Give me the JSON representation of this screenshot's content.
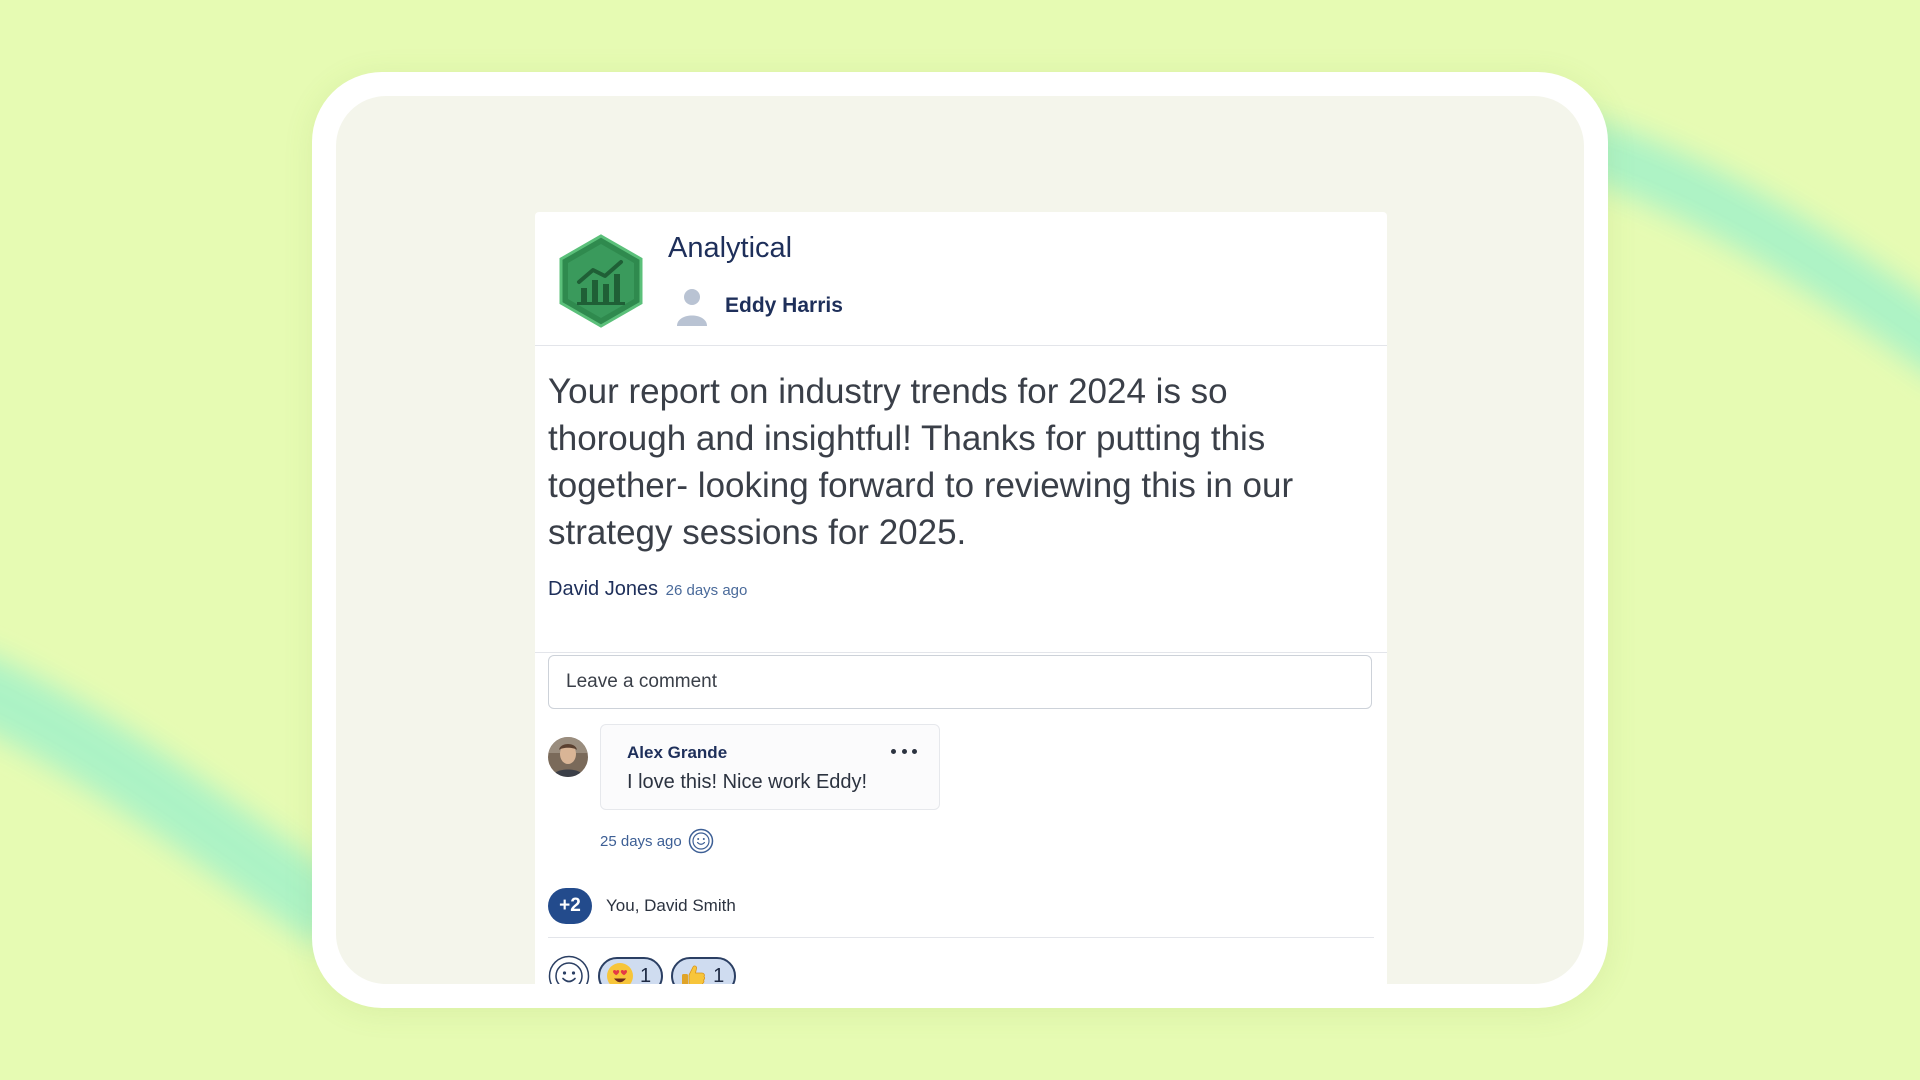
{
  "post": {
    "badge_title": "Analytical",
    "recipient": "Eddy Harris",
    "message": "Your report on industry trends for 2024 is so thorough and insightful! Thanks for putting this together- looking forward to reviewing this in our strategy sessions for 2025.",
    "sender": "David Jones",
    "sent_time": "26 days ago"
  },
  "comment_input": {
    "placeholder": "Leave a comment"
  },
  "comments": [
    {
      "author": "Alex Grande",
      "text": "I love this! Nice work Eddy!",
      "time": "25 days ago"
    }
  ],
  "reactors": {
    "count_label": "+2",
    "names": "You, David Smith"
  },
  "reactions": [
    {
      "emoji": "heart-eyes-emoji",
      "count": "1"
    },
    {
      "emoji": "thumbs-up-emoji",
      "count": "1"
    }
  ],
  "colors": {
    "background": "#e6fbb3",
    "accent_blue": "#234b8c",
    "badge_green": "#2e8b57",
    "text_navy": "#1e2f5a"
  }
}
